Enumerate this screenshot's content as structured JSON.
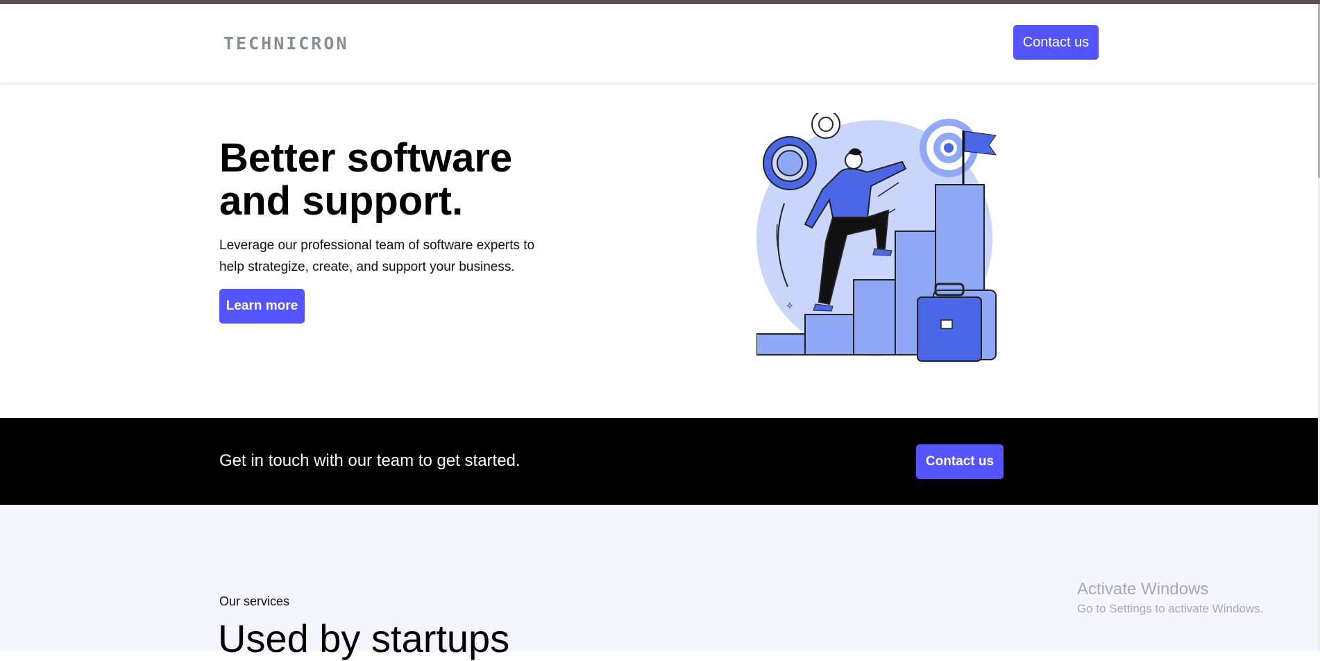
{
  "header": {
    "logo_text": "TECHNICRON",
    "contact_label": "Contact us"
  },
  "hero": {
    "title_line1": "Better software",
    "title_line2": "and support.",
    "subtitle_line1": "Leverage our professional team of software experts to",
    "subtitle_line2": "help strategize, create, and support your business.",
    "learn_more_label": "Learn more"
  },
  "cta": {
    "text": "Get in touch with our team to get started.",
    "contact_label": "Contact us"
  },
  "services": {
    "eyebrow": "Our services",
    "heading": "Used by startups"
  },
  "windows_watermark": {
    "title": "Activate Windows",
    "subtitle": "Go to Settings to activate Windows."
  },
  "colors": {
    "accent": "#5454ff",
    "band": "#000000",
    "services_bg": "#f4f5fd",
    "illustration_light": "#c9d5fb",
    "illustration_mid": "#8fa9f6",
    "illustration_dark": "#4a67e8"
  },
  "icons": {
    "hero_illustration": "person-climbing-bar-chart-illustration"
  }
}
